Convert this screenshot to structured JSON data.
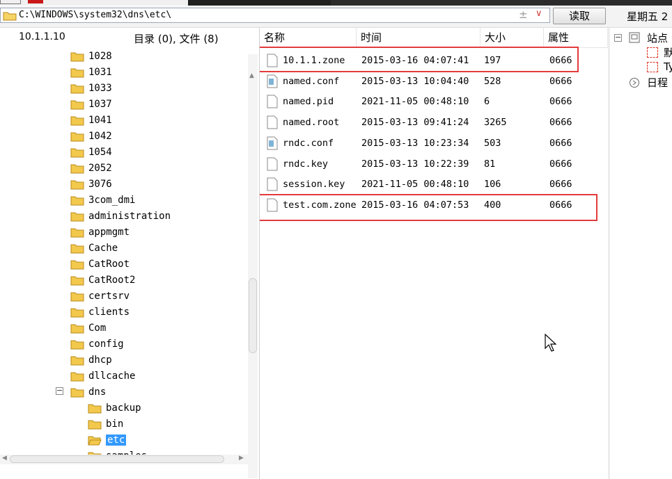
{
  "address_bar": {
    "path": "C:\\WINDOWS\\system32\\dns\\etc\\",
    "read_button": "读取",
    "weekday": "星期五 2"
  },
  "left_pane": {
    "host": "10.1.1.10",
    "summary": "目录 (0), 文件 (8)",
    "tree": [
      {
        "label": "1028"
      },
      {
        "label": "1031"
      },
      {
        "label": "1033"
      },
      {
        "label": "1037"
      },
      {
        "label": "1041"
      },
      {
        "label": "1042"
      },
      {
        "label": "1054"
      },
      {
        "label": "2052"
      },
      {
        "label": "3076"
      },
      {
        "label": "3com_dmi"
      },
      {
        "label": "administration"
      },
      {
        "label": "appmgmt"
      },
      {
        "label": "Cache"
      },
      {
        "label": "CatRoot"
      },
      {
        "label": "CatRoot2"
      },
      {
        "label": "certsrv"
      },
      {
        "label": "clients"
      },
      {
        "label": "Com"
      },
      {
        "label": "config"
      },
      {
        "label": "dhcp"
      },
      {
        "label": "dllcache"
      },
      {
        "label": "dns"
      },
      {
        "label": "backup"
      },
      {
        "label": "bin"
      },
      {
        "label": "etc"
      },
      {
        "label": "samples"
      }
    ]
  },
  "file_list": {
    "columns": {
      "name": "名称",
      "time": "时间",
      "size": "大小",
      "attr": "属性"
    },
    "rows": [
      {
        "name": "10.1.1.zone",
        "time": "2015-03-16 04:07:41",
        "size": "197",
        "attr": "0666"
      },
      {
        "name": "named.conf",
        "time": "2015-03-13 10:04:40",
        "size": "528",
        "attr": "0666"
      },
      {
        "name": "named.pid",
        "time": "2021-11-05 00:48:10",
        "size": "6",
        "attr": "0666"
      },
      {
        "name": "named.root",
        "time": "2015-03-13 09:41:24",
        "size": "3265",
        "attr": "0666"
      },
      {
        "name": "rndc.conf",
        "time": "2015-03-13 10:23:34",
        "size": "503",
        "attr": "0666"
      },
      {
        "name": "rndc.key",
        "time": "2015-03-13 10:22:39",
        "size": "81",
        "attr": "0666"
      },
      {
        "name": "session.key",
        "time": "2021-11-05 00:48:10",
        "size": "106",
        "attr": "0666"
      },
      {
        "name": "test.com.zone",
        "time": "2015-03-16 04:07:53",
        "size": "400",
        "attr": "0666"
      }
    ]
  },
  "right_pane": {
    "site_label": "站点",
    "item1": "默",
    "item2": "Ty",
    "schedule_label": "日程"
  },
  "colors": {
    "highlight": "#e23b3b",
    "selection": "#3399ff",
    "folder": "#f2c94c"
  }
}
